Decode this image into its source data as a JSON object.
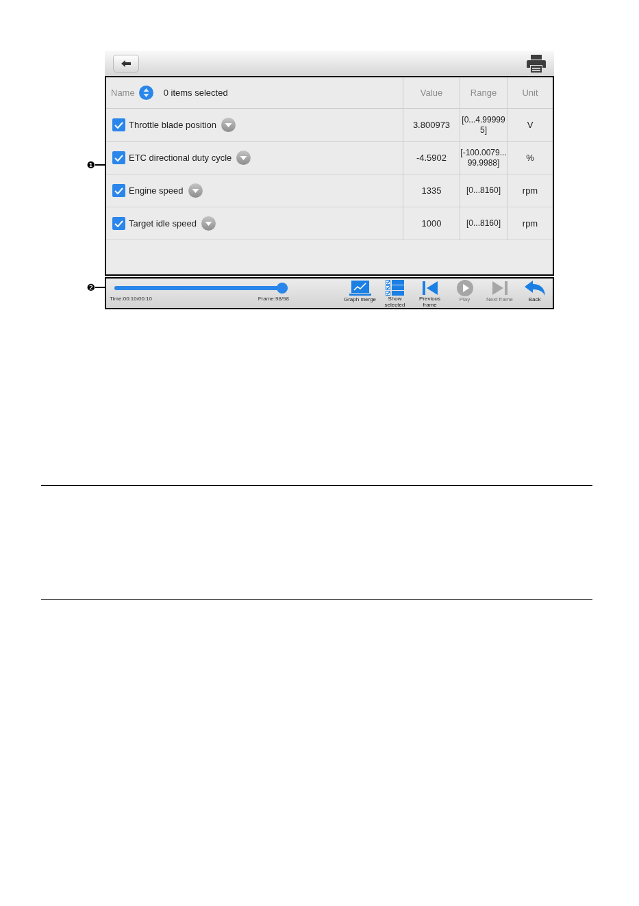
{
  "data_table": {
    "callout": "❶",
    "name_header": "Name",
    "selection_status": "0 items selected",
    "columns": [
      "Value",
      "Range",
      "Unit"
    ],
    "rows": [
      {
        "name": "Throttle blade position",
        "checked": true,
        "value": "3.800973",
        "range": "[0...4.999995]",
        "unit": "V"
      },
      {
        "name": "ETC directional duty cycle",
        "checked": true,
        "value": "-4.5902",
        "range": "[-100.0079...99.9988]",
        "unit": "%"
      },
      {
        "name": "Engine speed",
        "checked": true,
        "value": "1335",
        "range": "[0...8160]",
        "unit": "rpm"
      },
      {
        "name": "Target idle speed",
        "checked": true,
        "value": "1000",
        "range": "[0...8160]",
        "unit": "rpm"
      }
    ]
  },
  "playback_bar": {
    "callout": "❷",
    "slider": {
      "level": 1
    },
    "time": "Time:00:10/00:10",
    "frame": "Frame:98/98",
    "buttons": [
      {
        "label": "Graph merge",
        "kind": "graph",
        "disabled": false
      },
      {
        "label": "Show selected",
        "kind": "list",
        "disabled": false
      },
      {
        "label": "Previous frame",
        "kind": "previous",
        "disabled": false
      },
      {
        "label": "Play",
        "kind": "play",
        "disabled": true
      },
      {
        "label": "Next frame",
        "kind": "next",
        "disabled": true
      },
      {
        "label": "Back",
        "kind": "back",
        "disabled": false
      }
    ]
  }
}
